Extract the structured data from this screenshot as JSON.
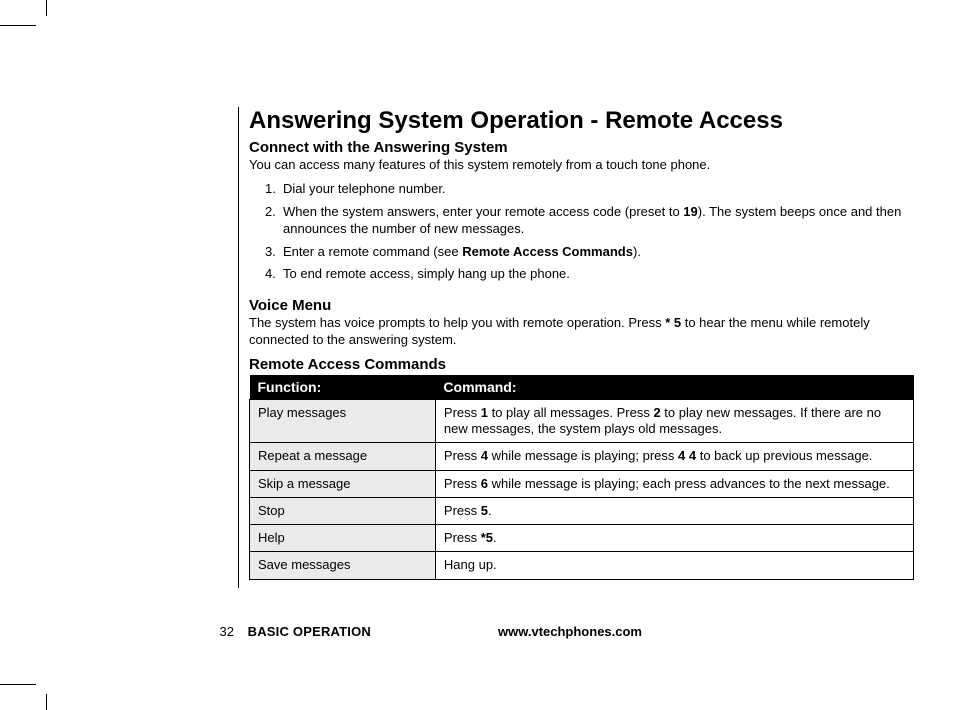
{
  "title": "Answering System Operation - Remote Access",
  "connect": {
    "heading": "Connect with the Answering System",
    "intro": "You can access many features of this system remotely from a touch tone phone.",
    "steps": [
      {
        "text": "Dial your telephone number."
      },
      {
        "pre": "When the system answers, enter your remote access code (preset to ",
        "b1": "19",
        "post1": "). The system beeps once and then announces the number of new messages."
      },
      {
        "pre": "Enter a remote command (see ",
        "b1": "Remote Access Commands",
        "post1": ")."
      },
      {
        "text": "To end remote access, simply hang up the phone."
      }
    ]
  },
  "voice": {
    "heading": "Voice Menu",
    "pre": "The system has voice prompts to help you with remote operation. Press ",
    "b1": "* 5",
    "post": " to hear the menu while remotely connected to the answering system."
  },
  "commands": {
    "heading": "Remote Access Commands",
    "col_function": "Function:",
    "col_command": "Command:",
    "rows": [
      {
        "function": "Play messages",
        "cmd_pre": "Press ",
        "cmd_b1": "1",
        "cmd_mid1": " to play all messages. Press ",
        "cmd_b2": "2",
        "cmd_mid2": " to play new messages. If there are no new messages, the system plays old messages."
      },
      {
        "function": "Repeat a message",
        "cmd_pre": "Press ",
        "cmd_b1": "4",
        "cmd_mid1": " while message is playing; press ",
        "cmd_b2": "4 4",
        "cmd_mid2": " to back up previous message."
      },
      {
        "function": "Skip a message",
        "cmd_pre": "Press ",
        "cmd_b1": "6",
        "cmd_mid1": " while message is playing; each press advances to the next message.",
        "cmd_b2": "",
        "cmd_mid2": ""
      },
      {
        "function": "Stop",
        "cmd_pre": "Press ",
        "cmd_b1": "5",
        "cmd_mid1": ".",
        "cmd_b2": "",
        "cmd_mid2": ""
      },
      {
        "function": "Help",
        "cmd_pre": "Press ",
        "cmd_b1": "*5",
        "cmd_mid1": ".",
        "cmd_b2": "",
        "cmd_mid2": ""
      },
      {
        "function": "Save messages",
        "cmd_pre": "Hang up.",
        "cmd_b1": "",
        "cmd_mid1": "",
        "cmd_b2": "",
        "cmd_mid2": ""
      }
    ]
  },
  "footer": {
    "page": "32",
    "section": "BASIC OPERATION",
    "site": "www.vtechphones.com"
  }
}
